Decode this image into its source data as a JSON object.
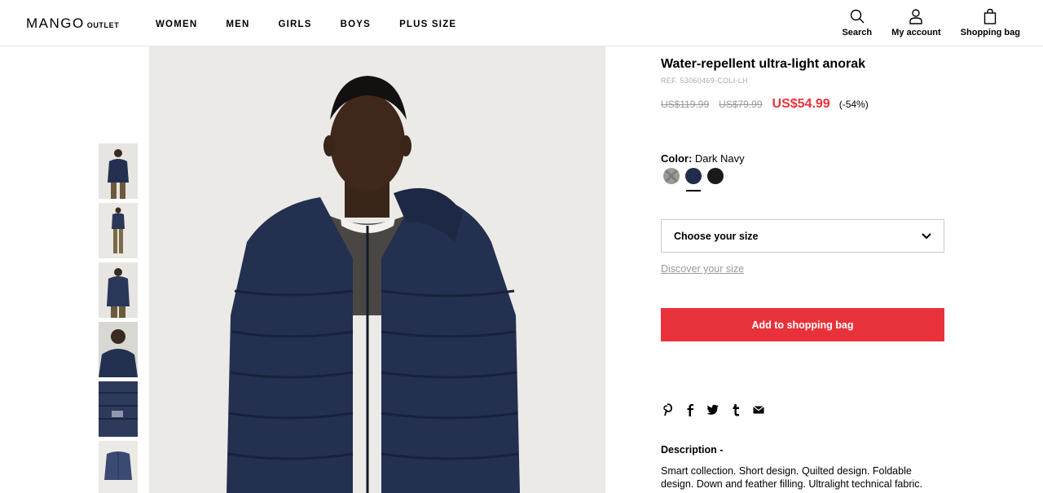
{
  "header": {
    "logo": "MANGO",
    "logo_sub": "OUTLET",
    "nav": [
      "WOMEN",
      "MEN",
      "GIRLS",
      "BOYS",
      "PLUS SIZE"
    ],
    "search_label": "Search",
    "account_label": "My account",
    "bag_label": "Shopping bag"
  },
  "product": {
    "title": "Water-repellent ultra-light anorak",
    "ref": "REF. 53060469-COLI-LH",
    "original_price": "US$119.99",
    "previous_price": "US$79.99",
    "sale_price": "US$54.99",
    "discount": "(-54%)",
    "color_label": "Color:",
    "color_value": "Dark Navy",
    "swatches": [
      {
        "name": "grey",
        "color": "#9a9a98"
      },
      {
        "name": "dark-navy",
        "color": "#1f2c4a",
        "selected": true
      },
      {
        "name": "black",
        "color": "#1a1a1a"
      }
    ],
    "size_placeholder": "Choose your size",
    "discover_size": "Discover your size",
    "add_button": "Add to shopping bag",
    "description_title": "Description -",
    "description": "Smart collection. Short design. Quilted design. Foldable design. Down and feather filling. Ultralight technical fabric."
  },
  "social": [
    "pinterest-icon",
    "facebook-icon",
    "twitter-icon",
    "tumblr-icon",
    "email-icon"
  ],
  "colors": {
    "accent_red": "#e8323b",
    "jacket_navy": "#23304f"
  }
}
